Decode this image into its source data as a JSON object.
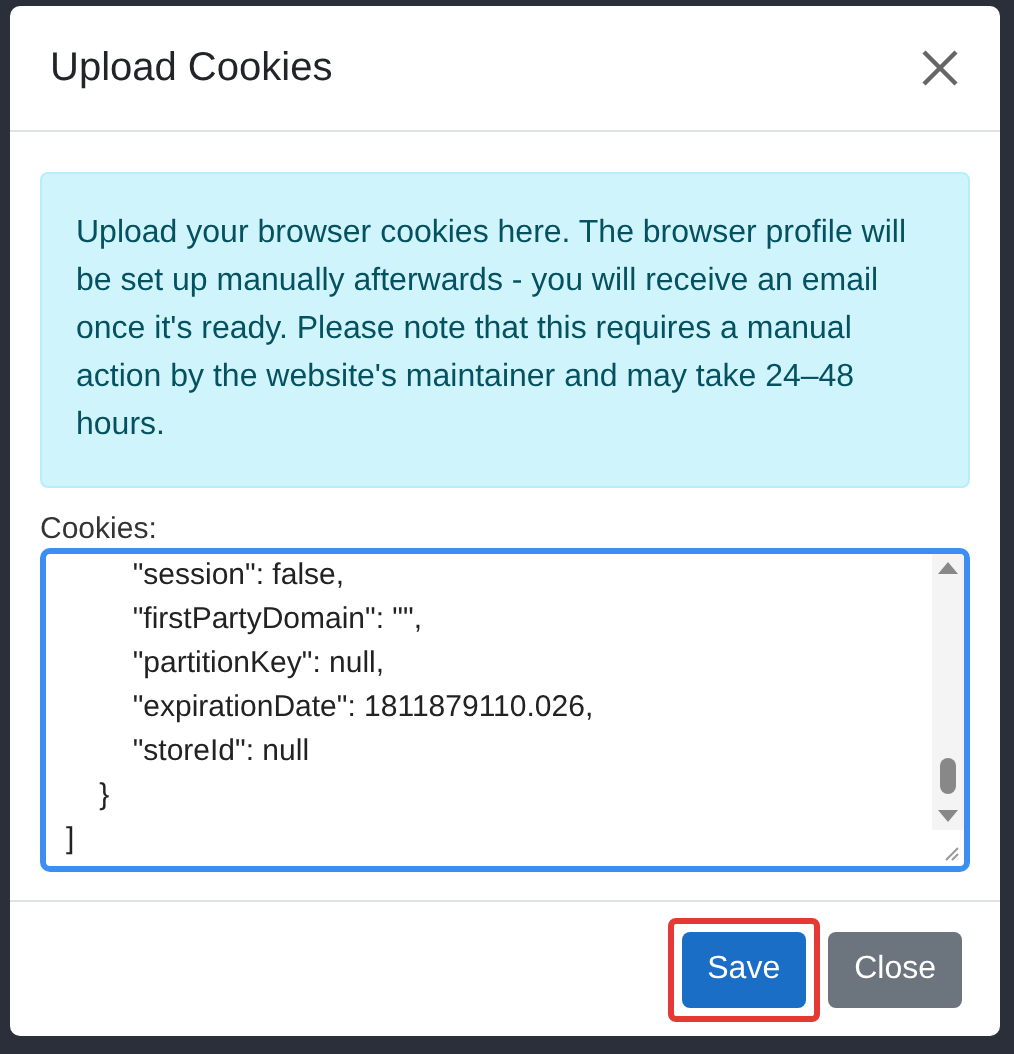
{
  "dialog": {
    "title": "Upload Cookies",
    "alert": "Upload your browser cookies here. The browser profile will be set up manually afterwards - you will receive an email once it's ready. Please note that this requires a manual action by the website's maintainer and may take 24–48 hours.",
    "field": {
      "label": "Cookies:",
      "value": "        \"session\": false,\n        \"firstPartyDomain\": \"\",\n        \"partitionKey\": null,\n        \"expirationDate\": 1811879110.026,\n        \"storeId\": null\n    }\n]",
      "focused": true
    },
    "buttons": [
      {
        "kind": "primary",
        "label": "Save",
        "highlighted": true
      },
      {
        "kind": "secondary",
        "label": "Close",
        "highlighted": false
      }
    ]
  }
}
